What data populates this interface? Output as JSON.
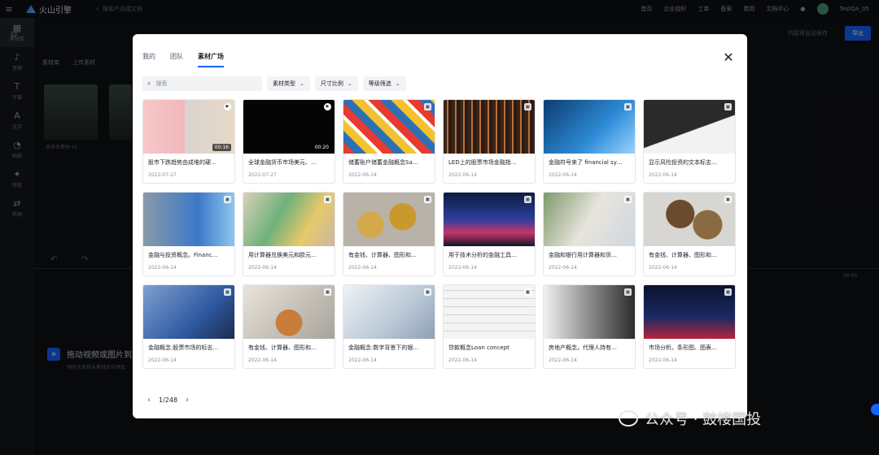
{
  "app": {
    "brand": "火山引擎",
    "search_placeholder": "搜索产品或文档",
    "top_links": [
      "首页",
      "企业组织",
      "工单",
      "备案",
      "费用",
      "文档中心"
    ],
    "user": "TestQA_05",
    "save_hint": "内容将自动保存",
    "export_label": "导出"
  },
  "left_rail": [
    {
      "icon": "grid-icon",
      "glyph": "▦",
      "label": "素材库"
    },
    {
      "icon": "music-icon",
      "glyph": "♪",
      "label": "音频"
    },
    {
      "icon": "text-icon",
      "glyph": "T",
      "label": "字幕"
    },
    {
      "icon": "text-icon",
      "glyph": "A",
      "label": "文字"
    },
    {
      "icon": "sticker-icon",
      "glyph": "◔",
      "label": "贴纸"
    },
    {
      "icon": "effect-icon",
      "glyph": "✦",
      "label": "特效"
    },
    {
      "icon": "transition-icon",
      "glyph": "⇄",
      "label": "转场"
    }
  ],
  "bg_panel": {
    "tabs": [
      "素材库",
      "上传素材"
    ],
    "thumb_label": "未命名素材 01",
    "drop_title": "拖动视频或图片到此处",
    "drop_sub": "同时也支持从素材库中添加",
    "time": "00:00"
  },
  "modal": {
    "tabs": [
      {
        "label": "我的",
        "active": false
      },
      {
        "label": "团队",
        "active": false
      },
      {
        "label": "素材广场",
        "active": true
      }
    ],
    "search_placeholder": "搜索",
    "filters": [
      "素材类型",
      "尺寸比例",
      "等级筛选"
    ],
    "pagination": {
      "current": 1,
      "total": 248,
      "label": "1/248"
    }
  },
  "assets": [
    {
      "title": "股市下跌趋势由成堆的硬…",
      "date": "2022-07-27",
      "type": "video",
      "duration": "00:16"
    },
    {
      "title": "全球金融货币市场美元、…",
      "date": "2022-07-27",
      "type": "video",
      "duration": "00:20"
    },
    {
      "title": "储蓄账户储蓄金融概念Sa…",
      "date": "2022-06-14",
      "type": "image"
    },
    {
      "title": "LED上的股票市场金融指…",
      "date": "2022-06-14",
      "type": "image"
    },
    {
      "title": "金融符号来了 financial sy…",
      "date": "2022-06-14",
      "type": "image"
    },
    {
      "title": "显示风险投资的文本标志…",
      "date": "2022-06-14",
      "type": "image"
    },
    {
      "title": "金融与投资概念。Financ…",
      "date": "2022-06-14",
      "type": "image"
    },
    {
      "title": "用计算器兑换美元和欧元…",
      "date": "2022-06-14",
      "type": "image"
    },
    {
      "title": "有金钱、计算器、图形和…",
      "date": "2022-06-14",
      "type": "image"
    },
    {
      "title": "用于技术分析的金融工具…",
      "date": "2022-06-14",
      "type": "image"
    },
    {
      "title": "金融和银行用计算器和货…",
      "date": "2022-06-14",
      "type": "image"
    },
    {
      "title": "有金钱、计算器、图形和…",
      "date": "2022-06-14",
      "type": "image"
    },
    {
      "title": "金融概念:股票市场的标志…",
      "date": "2022-06-14",
      "type": "image"
    },
    {
      "title": "有金钱、计算器、图形和…",
      "date": "2022-06-14",
      "type": "image"
    },
    {
      "title": "金融概念:数字背景下的银…",
      "date": "2022-06-14",
      "type": "image"
    },
    {
      "title": "贷款概念Loan concept",
      "date": "2022-06-14",
      "type": "image"
    },
    {
      "title": "房地产概念，代理人持有…",
      "date": "2022-06-14",
      "type": "image"
    },
    {
      "title": "市场分析。条形图、图表…",
      "date": "2022-06-14",
      "type": "image"
    }
  ],
  "watermark": "公众号 · 鼓楼国投"
}
